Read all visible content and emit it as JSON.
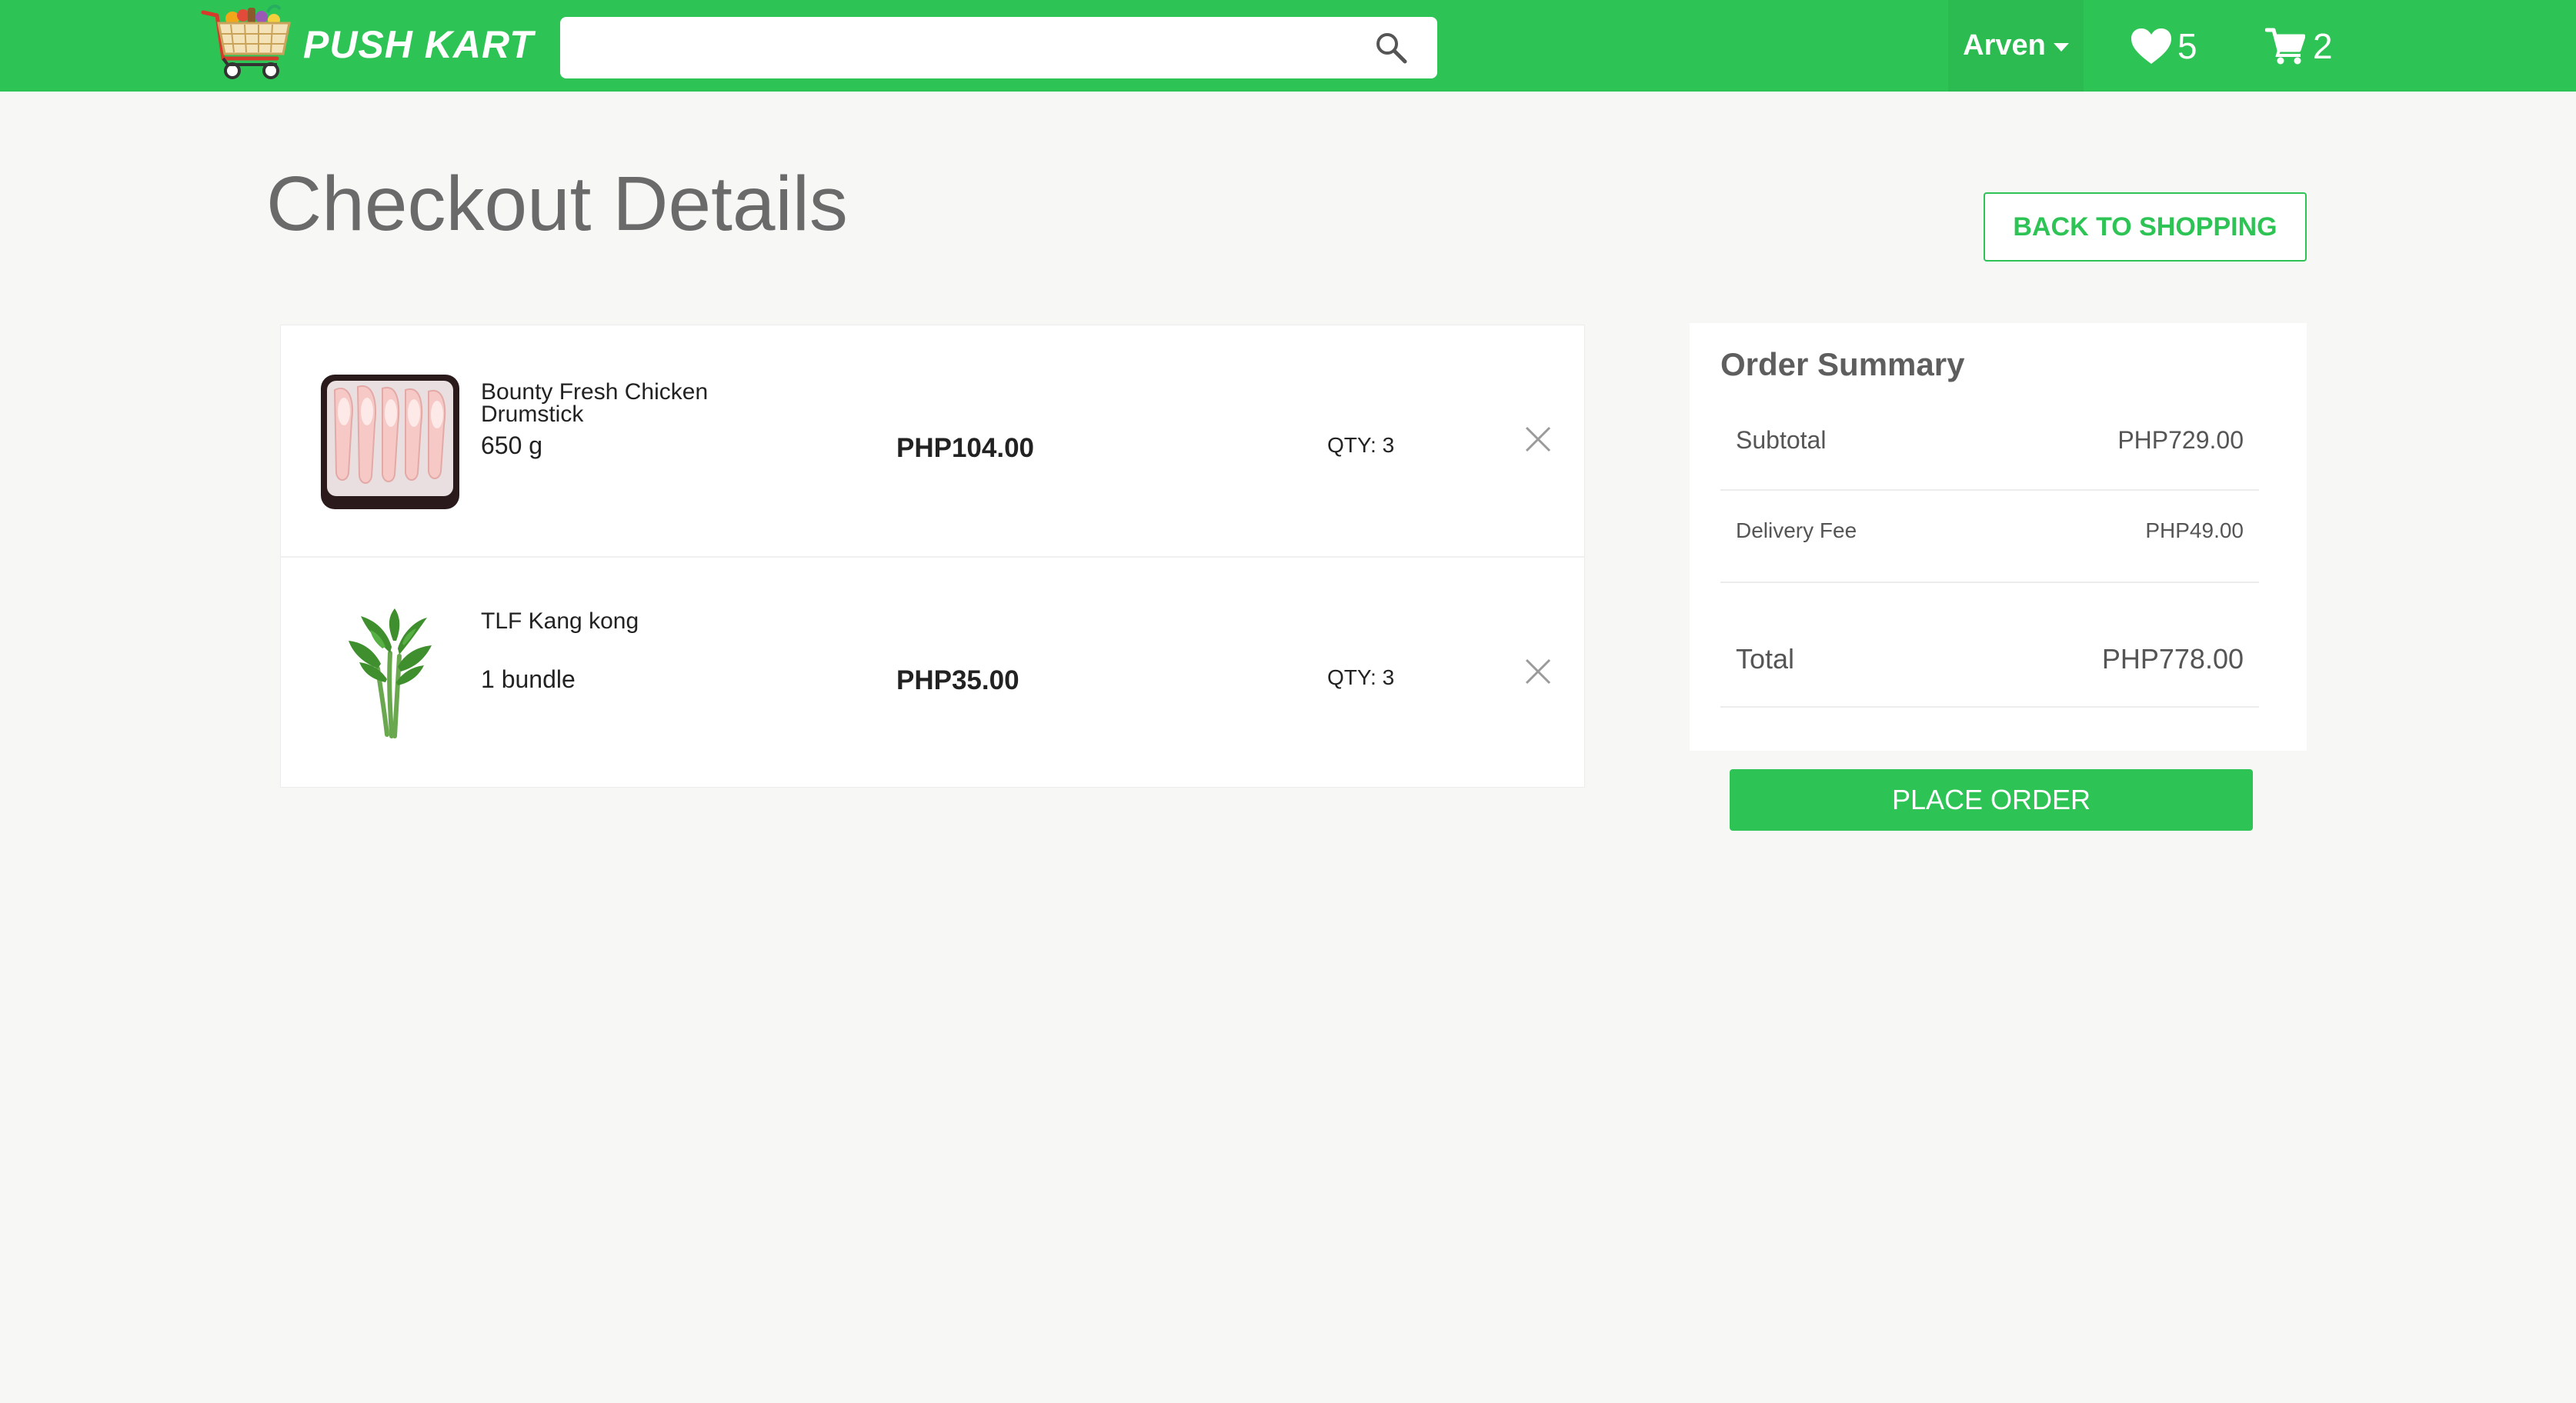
{
  "brand": {
    "name": "PUSH KART"
  },
  "search": {
    "value": "",
    "placeholder": ""
  },
  "user_menu": {
    "name": "Arven"
  },
  "wishlist": {
    "count": "5"
  },
  "cart": {
    "count": "2"
  },
  "page": {
    "title": "Checkout Details",
    "back_button_label": "BACK TO SHOPPING"
  },
  "cart_items": [
    {
      "name": "Bounty Fresh Chicken Drumstick",
      "size": "650 g",
      "price": "PHP104.00",
      "qty": "QTY: 3",
      "image_icon": "chicken-drumstick-image"
    },
    {
      "name": "TLF Kang kong",
      "size": "1 bundle",
      "price": "PHP35.00",
      "qty": "QTY: 3",
      "image_icon": "kang-kong-image"
    }
  ],
  "summary": {
    "title": "Order Summary",
    "subtotal_label": "Subtotal",
    "subtotal_value": "PHP729.00",
    "delivery_label": "Delivery Fee",
    "delivery_value": "PHP49.00",
    "total_label": "Total",
    "total_value": "PHP778.00",
    "place_order_label": "PLACE ORDER"
  },
  "colors": {
    "brand_green": "#2ec455",
    "page_background": "#f7f7f5",
    "title_gray": "#6a6a6a"
  }
}
